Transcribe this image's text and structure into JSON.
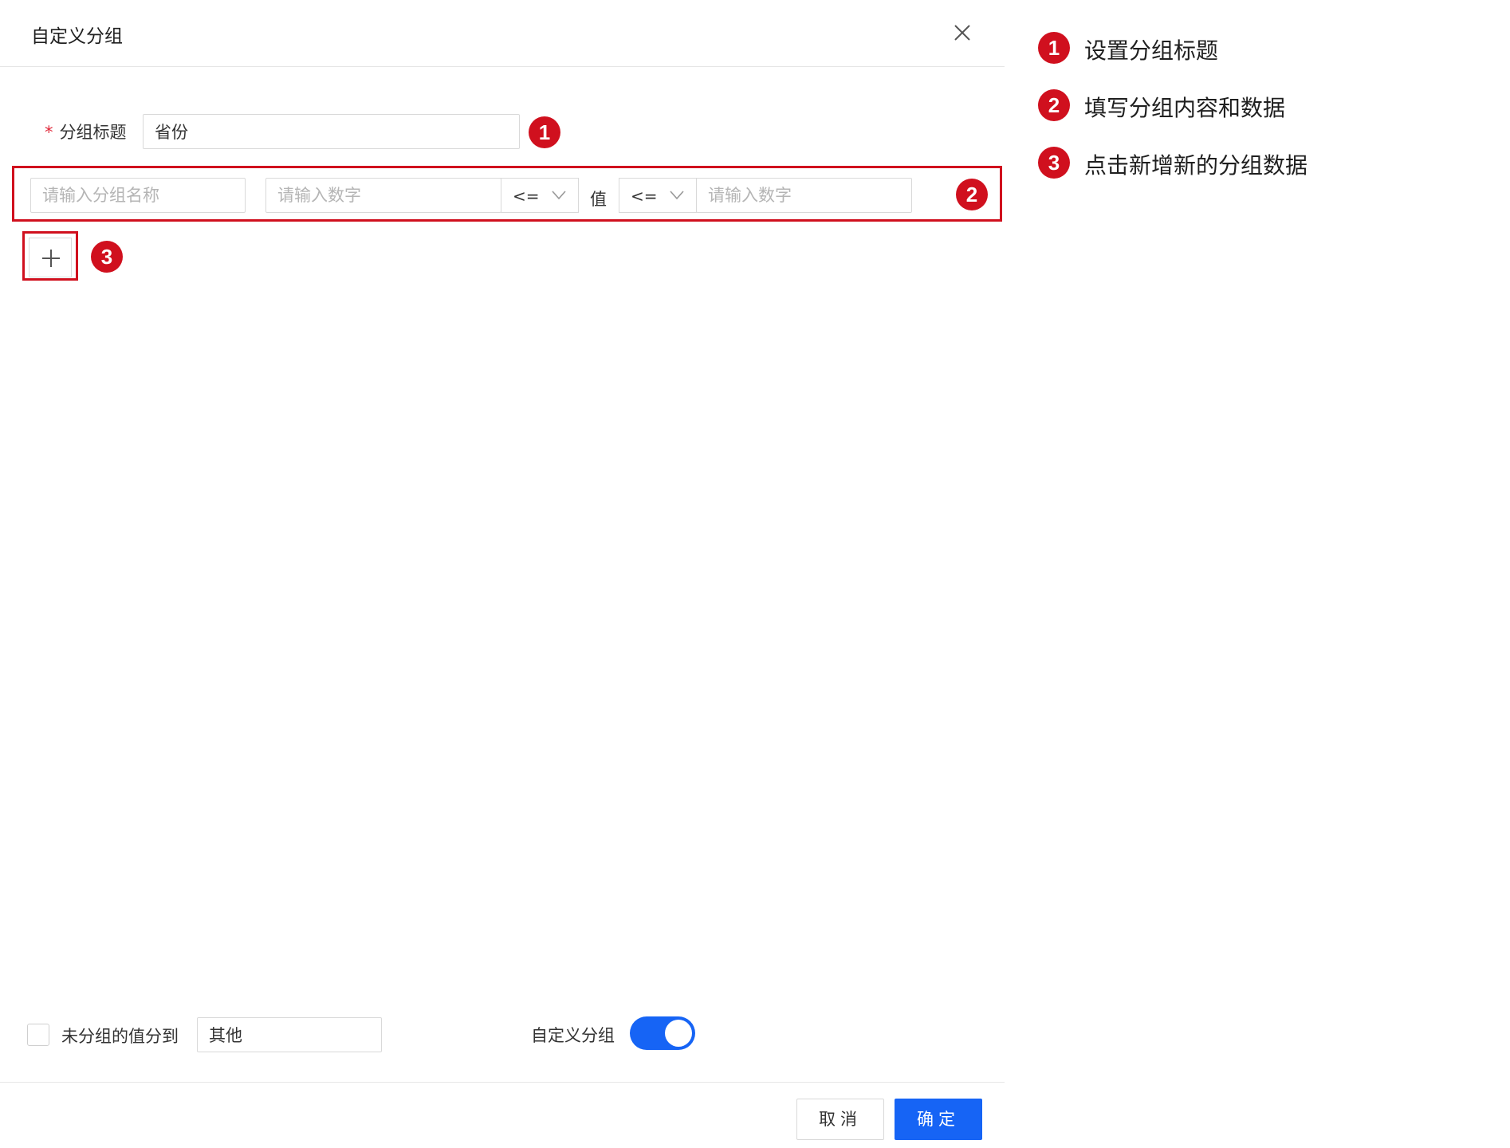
{
  "dialog": {
    "title": "自定义分组",
    "close_icon": "close-icon"
  },
  "group_title": {
    "required_mark": "*",
    "label": "分组标题",
    "value": "省份"
  },
  "group_row": {
    "name_placeholder": "请输入分组名称",
    "min_placeholder": "请输入数字",
    "min_operator": "<=",
    "value_label": "值",
    "max_operator": "<=",
    "max_placeholder": "请输入数字"
  },
  "add_button": {
    "icon": "plus-icon"
  },
  "footer_options": {
    "ungrouped_checked": false,
    "ungrouped_label": "未分组的值分到",
    "ungrouped_value": "其他",
    "custom_group_label": "自定义分组",
    "custom_group_enabled": true
  },
  "buttons": {
    "cancel": "取消",
    "ok": "确定"
  },
  "annotations": [
    {
      "number": "1",
      "text": "设置分组标题"
    },
    {
      "number": "2",
      "text": "填写分组内容和数据"
    },
    {
      "number": "3",
      "text": "点击新增新的分组数据"
    }
  ],
  "colors": {
    "primary": "#1664f5",
    "annotation_red": "#d0101e",
    "required_red": "#e0283a"
  }
}
